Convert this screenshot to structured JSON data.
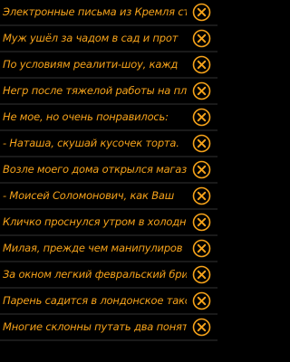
{
  "colors": {
    "background": "#000000",
    "text": "#f5a21a",
    "icon": "#f5a21a",
    "divider": "#1a1a1a"
  },
  "items": [
    {
      "text": "Электронные письма из Кремля ст",
      "action_icon": "close-circle-icon"
    },
    {
      "text": "Муж ушёл за чадом в сад и прот",
      "action_icon": "close-circle-icon"
    },
    {
      "text": "По условиям реалити-шоу, кажд",
      "action_icon": "close-circle-icon"
    },
    {
      "text": "Негр после тяжелой работы на пл",
      "action_icon": "close-circle-icon"
    },
    {
      "text": "Не мое, но очень понравилось:",
      "action_icon": "close-circle-icon"
    },
    {
      "text": "- Наташа, скушай кусочек торта.",
      "action_icon": "close-circle-icon"
    },
    {
      "text": "Возле моего дома открылся магаз",
      "action_icon": "close-circle-icon"
    },
    {
      "text": "- Моисей Соломонович, как Ваш",
      "action_icon": "close-circle-icon"
    },
    {
      "text": "Кличко проснулся утром в холодн",
      "action_icon": "close-circle-icon"
    },
    {
      "text": "Милая, прежде чем манипулиров",
      "action_icon": "close-circle-icon"
    },
    {
      "text": "За окном легкий февральский бри",
      "action_icon": "close-circle-icon"
    },
    {
      "text": "Парень садится в лондонское такс",
      "action_icon": "close-circle-icon"
    },
    {
      "text": "Многие склонны путать два поняти",
      "action_icon": "close-circle-icon"
    }
  ]
}
